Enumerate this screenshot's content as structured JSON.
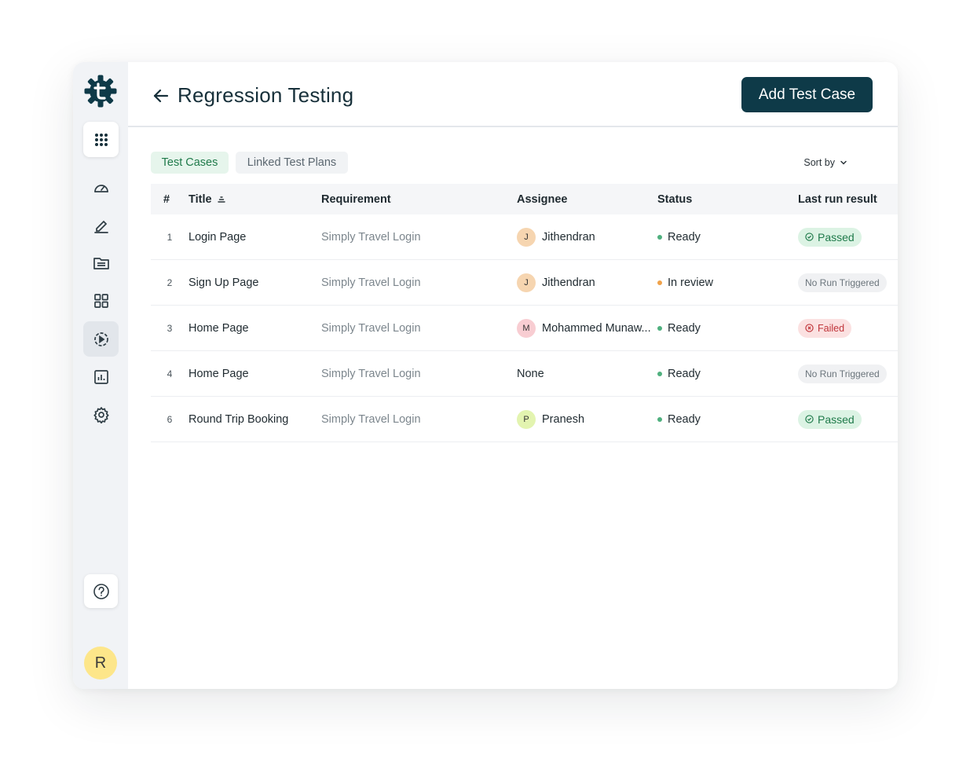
{
  "app": {
    "title": "Regression Testing",
    "add_button": "Add Test Case",
    "colors": {
      "brand": "#0e3a48",
      "passed": "#1f7a4a",
      "failed": "#c0353a",
      "ready": "#4fb07e",
      "review": "#f0a24a"
    }
  },
  "sidebar": {
    "logo_icon": "gear-t-logo",
    "items": [
      {
        "icon": "apps-grid-icon"
      },
      {
        "icon": "speedometer-icon"
      },
      {
        "icon": "pen-icon"
      },
      {
        "icon": "folder-icon"
      },
      {
        "icon": "dashboard-grid-icon"
      },
      {
        "icon": "test-run-icon"
      },
      {
        "icon": "bar-chart-icon"
      },
      {
        "icon": "settings-icon"
      }
    ],
    "help_icon": "help-icon",
    "user_initial": "R"
  },
  "tabs": [
    {
      "label": "Test Cases"
    },
    {
      "label": "Linked Test Plans"
    }
  ],
  "sort_label": "Sort by",
  "table": {
    "headers": [
      "#",
      "Title",
      "Requirement",
      "Assignee",
      "Status",
      "Last run result"
    ],
    "rows": [
      {
        "num": "1",
        "title": "Login Page",
        "requirement": "Simply Travel Login",
        "assignee": "Jithendran",
        "initial": "J",
        "avatar_color": "#f6d5b0",
        "status": "Ready",
        "status_color": "#4fb07e",
        "result": "Passed",
        "result_type": "passed"
      },
      {
        "num": "2",
        "title": "Sign Up Page",
        "requirement": "Simply Travel Login",
        "assignee": "Jithendran",
        "initial": "J",
        "avatar_color": "#f6d5b0",
        "status": "In review",
        "status_color": "#f0a24a",
        "result": "No Run Triggered",
        "result_type": "none"
      },
      {
        "num": "3",
        "title": "Home Page",
        "requirement": "Simply Travel Login",
        "assignee": "Mohammed Munaw...",
        "initial": "M",
        "avatar_color": "#f8cdd2",
        "status": "Ready",
        "status_color": "#4fb07e",
        "result": "Failed",
        "result_type": "failed"
      },
      {
        "num": "4",
        "title": "Home Page",
        "requirement": "Simply Travel Login",
        "assignee": "None",
        "initial": "",
        "avatar_color": "",
        "status": "Ready",
        "status_color": "#4fb07e",
        "result": "No Run Triggered",
        "result_type": "none"
      },
      {
        "num": "6",
        "title": "Round Trip Booking",
        "requirement": "Simply Travel Login",
        "assignee": "Pranesh",
        "initial": "P",
        "avatar_color": "#e3f4b0",
        "status": "Ready",
        "status_color": "#4fb07e",
        "result": "Passed",
        "result_type": "passed"
      }
    ]
  }
}
